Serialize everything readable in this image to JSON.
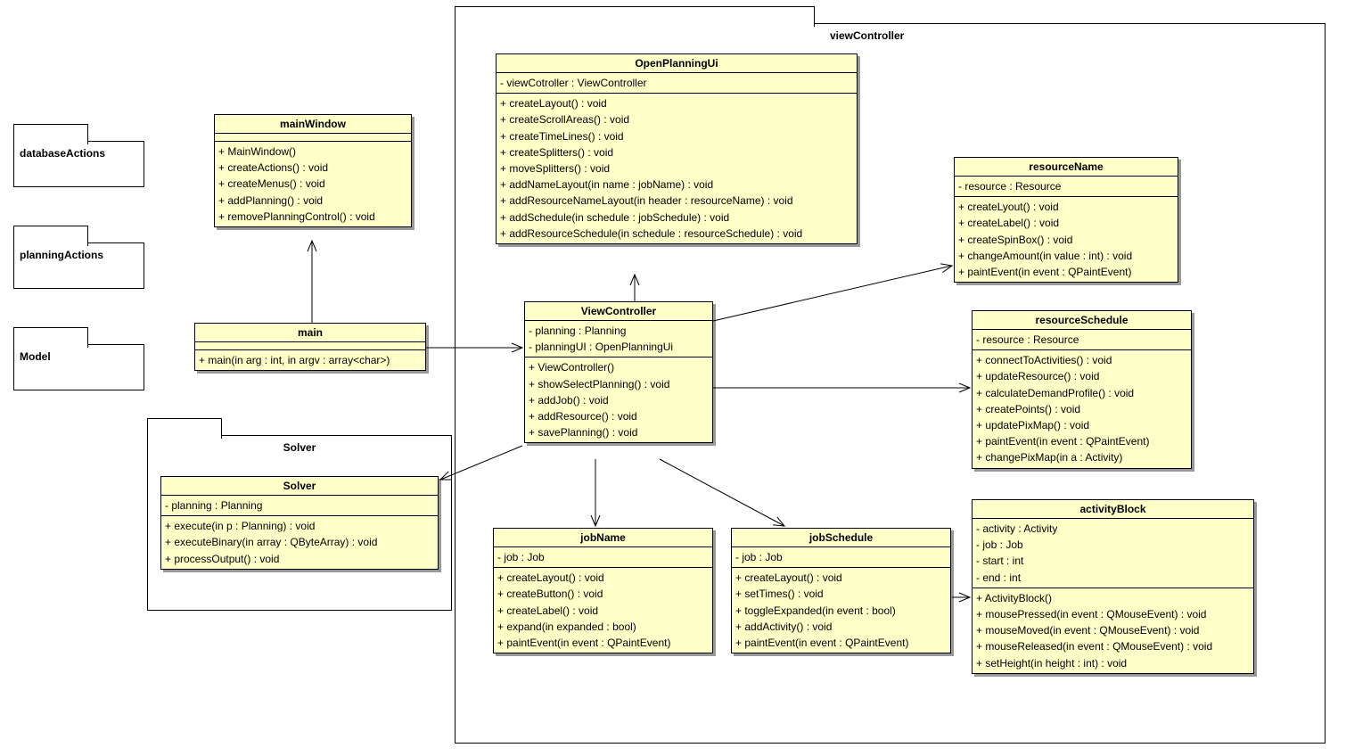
{
  "packages": {
    "viewController": "viewController",
    "databaseActions": "databaseActions",
    "planningActions": "planningActions",
    "model": "Model",
    "solver": "Solver"
  },
  "classes": {
    "mainWindow": {
      "title": "mainWindow",
      "attrs": [],
      "ops": [
        "+  MainWindow()",
        "+  createActions() : void",
        "+  createMenus() : void",
        "+  addPlanning() : void",
        "+  removePlanningControl() : void"
      ]
    },
    "main": {
      "title": "main",
      "attrs": [],
      "ops": [
        "+  main(in arg : int, in argv : array<char>)"
      ]
    },
    "solver": {
      "title": "Solver",
      "attrs": [
        "-  planning : Planning"
      ],
      "ops": [
        "+  execute(in p : Planning) : void",
        "+  executeBinary(in array : QByteArray) : void",
        "+  processOutput() : void"
      ]
    },
    "openPlanningUi": {
      "title": "OpenPlanningUi",
      "attrs": [
        "-  viewCotroller : ViewController"
      ],
      "ops": [
        "+  createLayout() : void",
        "+  createScrollAreas() : void",
        "+  createTimeLines() : void",
        "+  createSplitters() : void",
        "+  moveSplitters() : void",
        "+  addNameLayout(in name : jobName) : void",
        "+  addResourceNameLayout(in header : resourceName) : void",
        "+  addSchedule(in schedule : jobSchedule) : void",
        "+  addResourceSchedule(in schedule : resourceSchedule) : void"
      ]
    },
    "viewController": {
      "title": "ViewController",
      "attrs": [
        "-  planning : Planning",
        "-  planningUI : OpenPlanningUi"
      ],
      "ops": [
        "+  ViewController()",
        "+  showSelectPlanning() : void",
        "+  addJob() : void",
        "+  addResource() : void",
        "+  savePlanning() : void"
      ]
    },
    "resourceName": {
      "title": "resourceName",
      "attrs": [
        "-  resource : Resource"
      ],
      "ops": [
        "+  createLyout() : void",
        "+  createLabel() : void",
        "+  createSpinBox() : void",
        "+  changeAmount(in value : int) : void",
        "+  paintEvent(in event : QPaintEvent)"
      ]
    },
    "resourceSchedule": {
      "title": "resourceSchedule",
      "attrs": [
        "-  resource : Resource"
      ],
      "ops": [
        "+  connectToActivities() : void",
        "+  updateResource() : void",
        "+  calculateDemandProfile() : void",
        "+  createPoints() : void",
        "+  updatePixMap() : void",
        "+  paintEvent(in event : QPaintEvent)",
        "+  changePixMap(in a : Activity)"
      ]
    },
    "jobName": {
      "title": "jobName",
      "attrs": [
        "-  job : Job"
      ],
      "ops": [
        "+  createLayout() : void",
        "+  createButton() : void",
        "+  createLabel() : void",
        "+  expand(in expanded : bool)",
        "+  paintEvent(in event : QPaintEvent)"
      ]
    },
    "jobSchedule": {
      "title": "jobSchedule",
      "attrs": [
        "-  job : Job"
      ],
      "ops": [
        "+  createLayout() : void",
        "+  setTimes() : void",
        "+  toggleExpanded(in event : bool)",
        "+  addActivity() : void",
        "+  paintEvent(in event : QPaintEvent)"
      ]
    },
    "activityBlock": {
      "title": "activityBlock",
      "attrs": [
        "-  activity : Activity",
        "-  job : Job",
        "-  start : int",
        "-  end : int"
      ],
      "ops": [
        "+  ActivityBlock()",
        "+  mousePressed(in event : QMouseEvent) : void",
        "+  mouseMoved(in event : QMouseEvent) : void",
        "+  mouseReleased(in event : QMouseEvent) : void",
        "+  setHeight(in height : int) : void"
      ]
    }
  }
}
